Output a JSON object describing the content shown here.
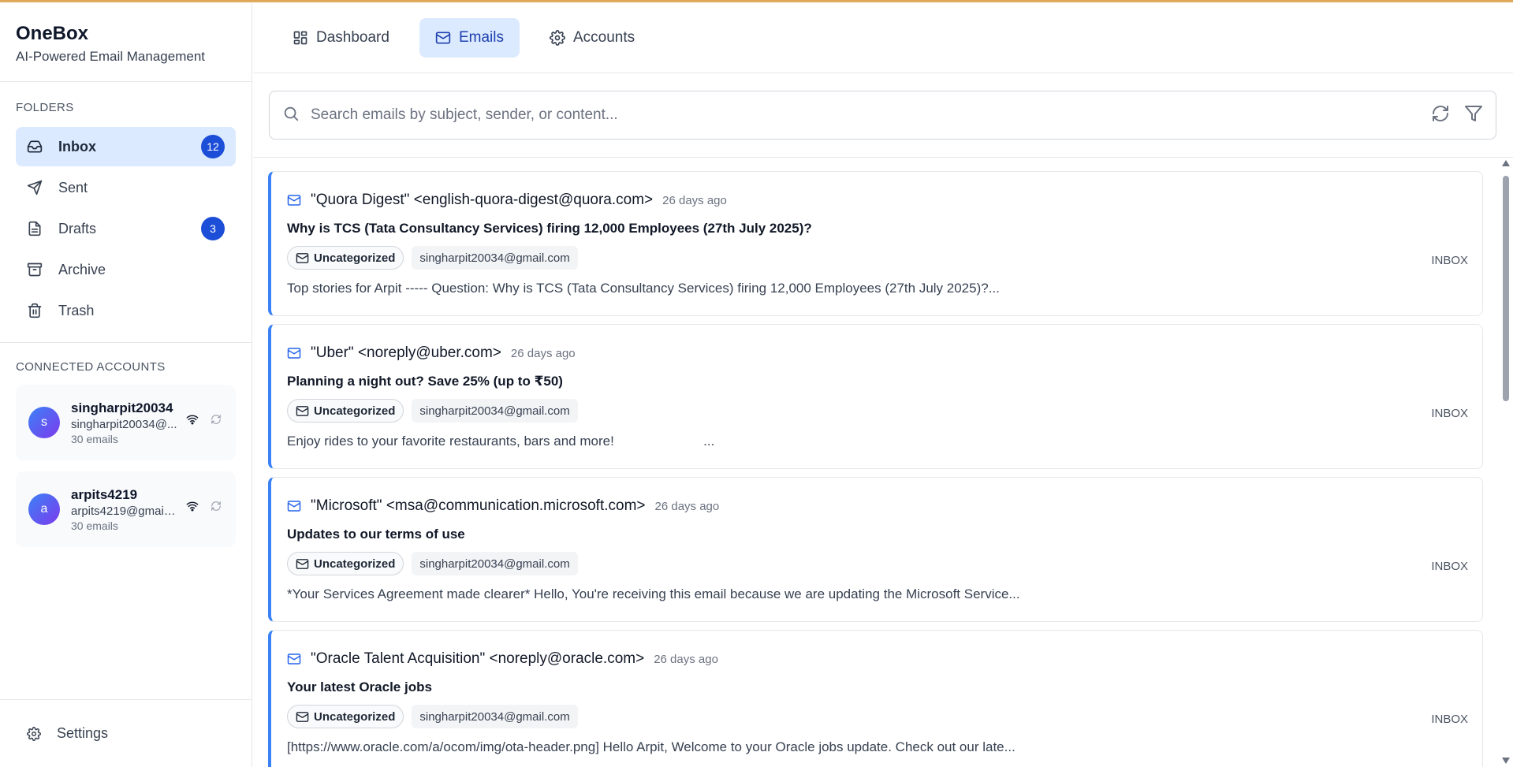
{
  "brand": {
    "title": "OneBox",
    "subtitle": "AI-Powered Email Management"
  },
  "sidebar": {
    "folders_label": "FOLDERS",
    "folders": [
      {
        "label": "Inbox",
        "icon": "inbox-icon",
        "badge": "12",
        "active": true
      },
      {
        "label": "Sent",
        "icon": "send-icon"
      },
      {
        "label": "Drafts",
        "icon": "file-icon",
        "badge": "3"
      },
      {
        "label": "Archive",
        "icon": "archive-icon"
      },
      {
        "label": "Trash",
        "icon": "trash-icon"
      }
    ],
    "accounts_label": "CONNECTED ACCOUNTS",
    "accounts": [
      {
        "initial": "s",
        "name": "singharpit20034",
        "email": "singharpit20034@...",
        "count": "30 emails"
      },
      {
        "initial": "a",
        "name": "arpits4219",
        "email": "arpits4219@gmail....",
        "count": "30 emails"
      }
    ],
    "settings_label": "Settings"
  },
  "nav": {
    "tabs": [
      {
        "label": "Dashboard",
        "icon": "dashboard-icon"
      },
      {
        "label": "Emails",
        "icon": "mail-icon",
        "active": true
      },
      {
        "label": "Accounts",
        "icon": "gear-icon"
      }
    ]
  },
  "search": {
    "placeholder": "Search emails by subject, sender, or content..."
  },
  "emails": [
    {
      "from": "\"Quora Digest\" <english-quora-digest@quora.com>",
      "time": "26 days ago",
      "subject": "Why is TCS (Tata Consultancy Services) firing 12,000 Employees (27th July 2025)?",
      "category": "Uncategorized",
      "account": "singharpit20034@gmail.com",
      "folder": "INBOX",
      "preview": "Top stories for Arpit ----- Question: Why is TCS (Tata Consultancy Services) firing 12,000 Employees (27th July 2025)?..."
    },
    {
      "from": "\"Uber\" <noreply@uber.com>",
      "time": "26 days ago",
      "subject": "Planning a night out? Save 25% (up to ₹50)",
      "category": "Uncategorized",
      "account": "singharpit20034@gmail.com",
      "folder": "INBOX",
      "preview": "Enjoy rides to your favorite restaurants, bars and more!                        ..."
    },
    {
      "from": "\"Microsoft\" <msa@communication.microsoft.com>",
      "time": "26 days ago",
      "subject": "Updates to our terms of use",
      "category": "Uncategorized",
      "account": "singharpit20034@gmail.com",
      "folder": "INBOX",
      "preview": "*Your Services Agreement made clearer* Hello, You're receiving this email because we are updating the Microsoft Service..."
    },
    {
      "from": "\"Oracle Talent Acquisition\" <noreply@oracle.com>",
      "time": "26 days ago",
      "subject": "Your latest Oracle jobs",
      "category": "Uncategorized",
      "account": "singharpit20034@gmail.com",
      "folder": "INBOX",
      "preview": "[https://www.oracle.com/a/ocom/img/ota-header.png] Hello Arpit, Welcome to your Oracle jobs update. Check out our late..."
    }
  ],
  "colors": {
    "accent": "#3b82f6",
    "badge": "#1d4ed8",
    "active_bg": "#dbeafe",
    "top_accent": "#e0a85b"
  }
}
